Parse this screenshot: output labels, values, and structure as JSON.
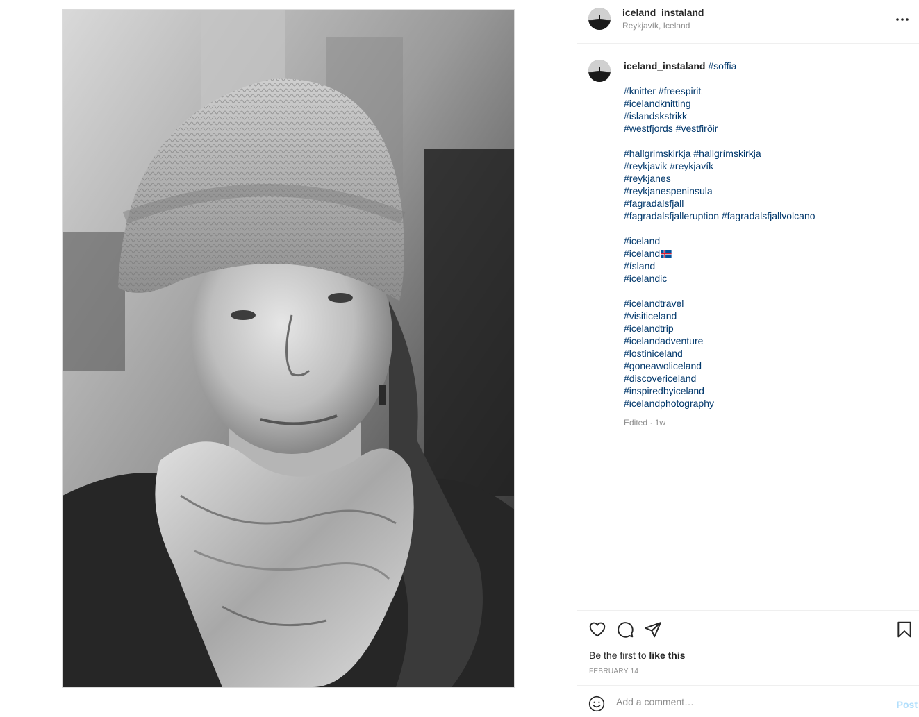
{
  "post": {
    "username": "iceland_instaland",
    "location": "Reykjavík, Iceland",
    "image_description_icon": "portrait-photo"
  },
  "caption": {
    "username": "iceland_instaland",
    "first_tag": "#soffia",
    "lines": [
      "",
      "#knitter #freespirit",
      "#icelandknitting",
      "#islandskstrikk",
      "#westfjords #vestfirðir",
      "",
      "#hallgrimskirkja #hallgrímskirkja",
      "#reykjavik #reykjavík",
      "#reykjanes",
      "#reykjanespeninsula",
      "#fagradalsfjall",
      "#fagradalsfjalleruption #fagradalsfjallvolcano",
      "",
      "#iceland",
      "#iceland",
      "#ísland",
      "#icelandic",
      "",
      "#icelandtravel",
      "#visiticeland",
      "#icelandtrip",
      "#icelandadventure",
      "#lostiniceland",
      "#goneawoliceland",
      "#discovericeland",
      "#inspiredbyiceland",
      "#icelandphotography"
    ],
    "flag_line_index": 14,
    "flag_icon": "iceland-flag-emoji",
    "meta": "Edited · 1w"
  },
  "actions": {
    "like_icon": "heart-icon",
    "comment_icon": "comment-icon",
    "share_icon": "paper-plane-icon",
    "save_icon": "bookmark-icon",
    "likes_prefix": "Be the first to",
    "likes_link": "like this",
    "date": "FEBRUARY 14"
  },
  "comment_box": {
    "emoji_icon": "smiley-icon",
    "placeholder": "Add a comment…",
    "post_label": "Post"
  },
  "colors": {
    "text": "#262626",
    "secondary": "#8e8e8e",
    "hashtag": "#00376b",
    "post_disabled": "#b2dffc",
    "divider": "#efefef"
  }
}
